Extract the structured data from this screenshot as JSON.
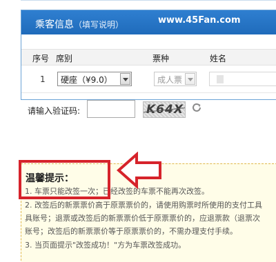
{
  "panel": {
    "title": "乘客信息",
    "subtitle": "（填写说明）",
    "watermark": "www.45Fan.com"
  },
  "table": {
    "headers": [
      "序号",
      "席别",
      "票种",
      "姓名"
    ],
    "rows": [
      {
        "index": "1",
        "seat": "硬座（¥9.0）",
        "ticket_type": "成人票"
      }
    ]
  },
  "captcha": {
    "label": "请输入验证码:",
    "value": "",
    "code": "K64X"
  },
  "tips": {
    "title": "温馨提示：",
    "items": [
      "1. 车票只能改签一次；已经改签的车票不能再次改签。",
      "2. 改签后的新票票价高于原票票价的，请使用购票时所使用的支付工具",
      "具账号；退票或改签后的新票票价低于原票票价的，应退票款（退票次",
      "账号；改签后的新票票价等于原票票价的，不需办理支付手续。",
      "3. 当页面提示\"改签成功！\"方为车票改签成功。"
    ]
  },
  "colors": {
    "header_blue": "#1f6bbb",
    "annotation_red": "#d6232b",
    "tips_bg": "#fffde8"
  }
}
